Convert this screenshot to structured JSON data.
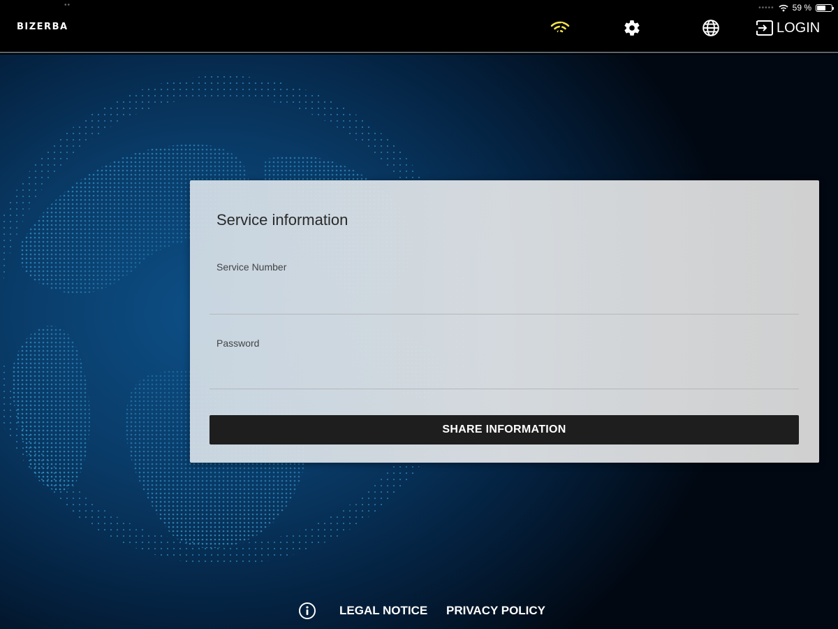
{
  "status_bar": {
    "battery_text": "59 %",
    "battery_level": 0.59,
    "icons": [
      "wifi-icon",
      "battery-icon"
    ]
  },
  "header": {
    "logo_text": "BIZERBA",
    "login_label": "LOGIN",
    "icons": [
      "wifi-signal-icon",
      "gear-icon",
      "globe-icon",
      "login-icon"
    ],
    "wifi_color": "#f2e34b"
  },
  "card": {
    "title": "Service information",
    "service_number": {
      "label": "Service Number",
      "value": "",
      "placeholder": ""
    },
    "password": {
      "label": "Password",
      "value": "",
      "placeholder": ""
    },
    "share_button_label": "SHARE INFORMATION"
  },
  "footer": {
    "legal_notice": "LEGAL NOTICE",
    "privacy_policy": "PRIVACY POLICY",
    "icons": [
      "info-icon"
    ]
  },
  "colors": {
    "accent_wifi": "#f2e34b",
    "button_bg": "#1e1e1e",
    "globe_dots": "#3aa9e0"
  }
}
